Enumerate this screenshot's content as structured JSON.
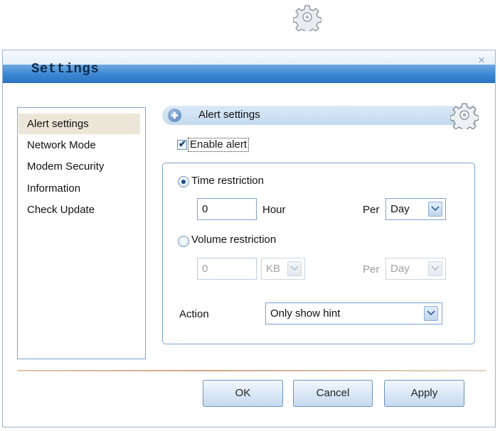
{
  "window": {
    "title": "Settings",
    "close_glyph": "×"
  },
  "icons": {
    "top": "gear-icon",
    "section": "gear-icon",
    "section_expand": "plus-circle-icon",
    "dropdown": "chevron-down-icon"
  },
  "nav": {
    "items": [
      {
        "label": "Alert settings",
        "selected": true
      },
      {
        "label": "Network Mode",
        "selected": false
      },
      {
        "label": "Modem Security",
        "selected": false
      },
      {
        "label": "Information",
        "selected": false
      },
      {
        "label": "Check Update",
        "selected": false
      }
    ]
  },
  "section": {
    "title": "Alert settings"
  },
  "alert": {
    "enable_label": "Enable alert",
    "enabled": true,
    "checkmark": "✔"
  },
  "time_restriction": {
    "label": "Time restriction",
    "selected": true,
    "value": "0",
    "unit": "Hour",
    "per_label": "Per",
    "period": "Day"
  },
  "volume_restriction": {
    "label": "Volume restriction",
    "selected": false,
    "value": "0",
    "unit": "KB",
    "per_label": "Per",
    "period": "Day"
  },
  "action": {
    "label": "Action",
    "value": "Only show hint"
  },
  "buttons": {
    "ok": "OK",
    "cancel": "Cancel",
    "apply": "Apply"
  },
  "colors": {
    "title_bar": "#3b86d2",
    "nav_selected": "#ece6d8",
    "border": "#7da2ce"
  }
}
